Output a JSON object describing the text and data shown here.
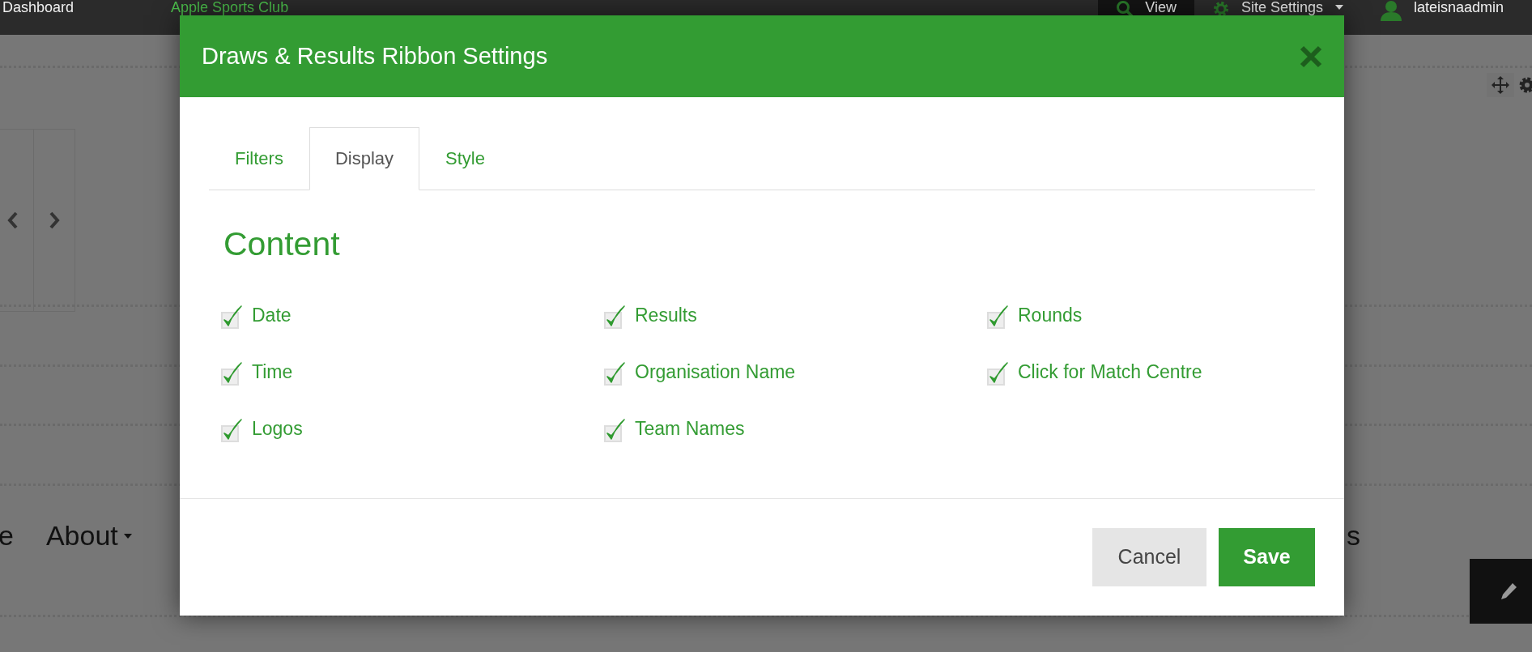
{
  "topbar": {
    "left_link": "Dashboard",
    "brand": "Apple Sports Club",
    "links": [
      {
        "kind": "search",
        "label": "View",
        "selected": true
      },
      {
        "kind": "settings",
        "label": "Site Settings",
        "selected": false
      }
    ],
    "user": "lateisnaadmin"
  },
  "page": {
    "nav_items": [
      {
        "label": "e",
        "dropdown": false
      },
      {
        "label": "About",
        "dropdown": true
      }
    ],
    "nav_right": "s"
  },
  "modal": {
    "title": "Draws & Results Ribbon Settings",
    "tabs": [
      {
        "label": "Filters",
        "selected": false
      },
      {
        "label": "Display",
        "selected": true
      },
      {
        "label": "Style",
        "selected": false
      }
    ],
    "heading": "Content",
    "columns": [
      [
        {
          "label": "Date",
          "checked": true
        },
        {
          "label": "Time",
          "checked": true
        },
        {
          "label": "Logos",
          "checked": true
        }
      ],
      [
        {
          "label": "Results",
          "checked": true
        },
        {
          "label": "Organisation Name",
          "checked": true
        },
        {
          "label": "Team Names",
          "checked": true
        }
      ],
      [
        {
          "label": "Rounds",
          "checked": true
        },
        {
          "label": "Click for Match Centre",
          "checked": true
        }
      ]
    ],
    "buttons": [
      {
        "kind": "secondary",
        "label": "Cancel"
      },
      {
        "kind": "primary",
        "label": "Save"
      }
    ]
  }
}
